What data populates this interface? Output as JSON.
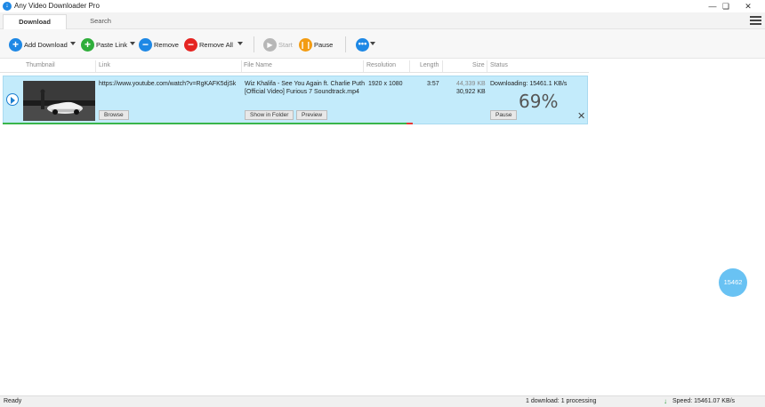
{
  "window": {
    "title": "Any Video Downloader Pro",
    "logo_glyph": "↓"
  },
  "tabs": [
    {
      "label": "Download",
      "active": true
    },
    {
      "label": "Search",
      "active": false
    }
  ],
  "toolbar": {
    "add_download": "Add Download",
    "paste_link": "Paste Link",
    "remove": "Remove",
    "remove_all": "Remove All",
    "start": "Start",
    "pause": "Pause",
    "colors": {
      "add": "#1e88e5",
      "paste": "#2fae3b",
      "remove": "#1e88e5",
      "remove_all": "#e52421",
      "start": "#b7b7b7",
      "pause": "#f39c12",
      "more": "#1e88e5"
    }
  },
  "columns": {
    "thumbnail": "Thumbnail",
    "link": "Link",
    "file_name": "File Name",
    "resolution": "Resolution",
    "length": "Length",
    "size": "Size",
    "status": "Status"
  },
  "download": {
    "link": "https://www.youtube.com/watch?v=RgKAFK5djSk",
    "file_name_line1": "Wiz Khalifa - See You Again ft. Charlie Puth",
    "file_name_line2": "[Official Video] Furious 7 Soundtrack.mp4",
    "resolution": "1920 x 1080",
    "length": "3:57",
    "size_downloaded": "44,339 KB",
    "size_total": "30,922 KB",
    "status_text": "Downloading: 15461.1 KB/s",
    "percent_label": "69%",
    "progress_fraction": 0.69,
    "secondary_fraction": 0.7,
    "buttons": {
      "browse": "Browse",
      "show_in_folder": "Show in Folder",
      "preview": "Preview",
      "pause": "Pause"
    }
  },
  "speed_bubble": "15462",
  "statusbar": {
    "ready": "Ready",
    "summary": "1 download: 1 processing",
    "speed": "Speed: 15461.07 KB/s"
  }
}
